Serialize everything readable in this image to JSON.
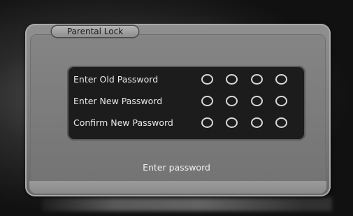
{
  "dialog": {
    "title": "Parental Lock",
    "status": "Enter password"
  },
  "rows": [
    {
      "label": "Enter Old Password",
      "digits": 4
    },
    {
      "label": "Enter New Password",
      "digits": 4
    },
    {
      "label": "Confirm New Password",
      "digits": 4
    }
  ]
}
